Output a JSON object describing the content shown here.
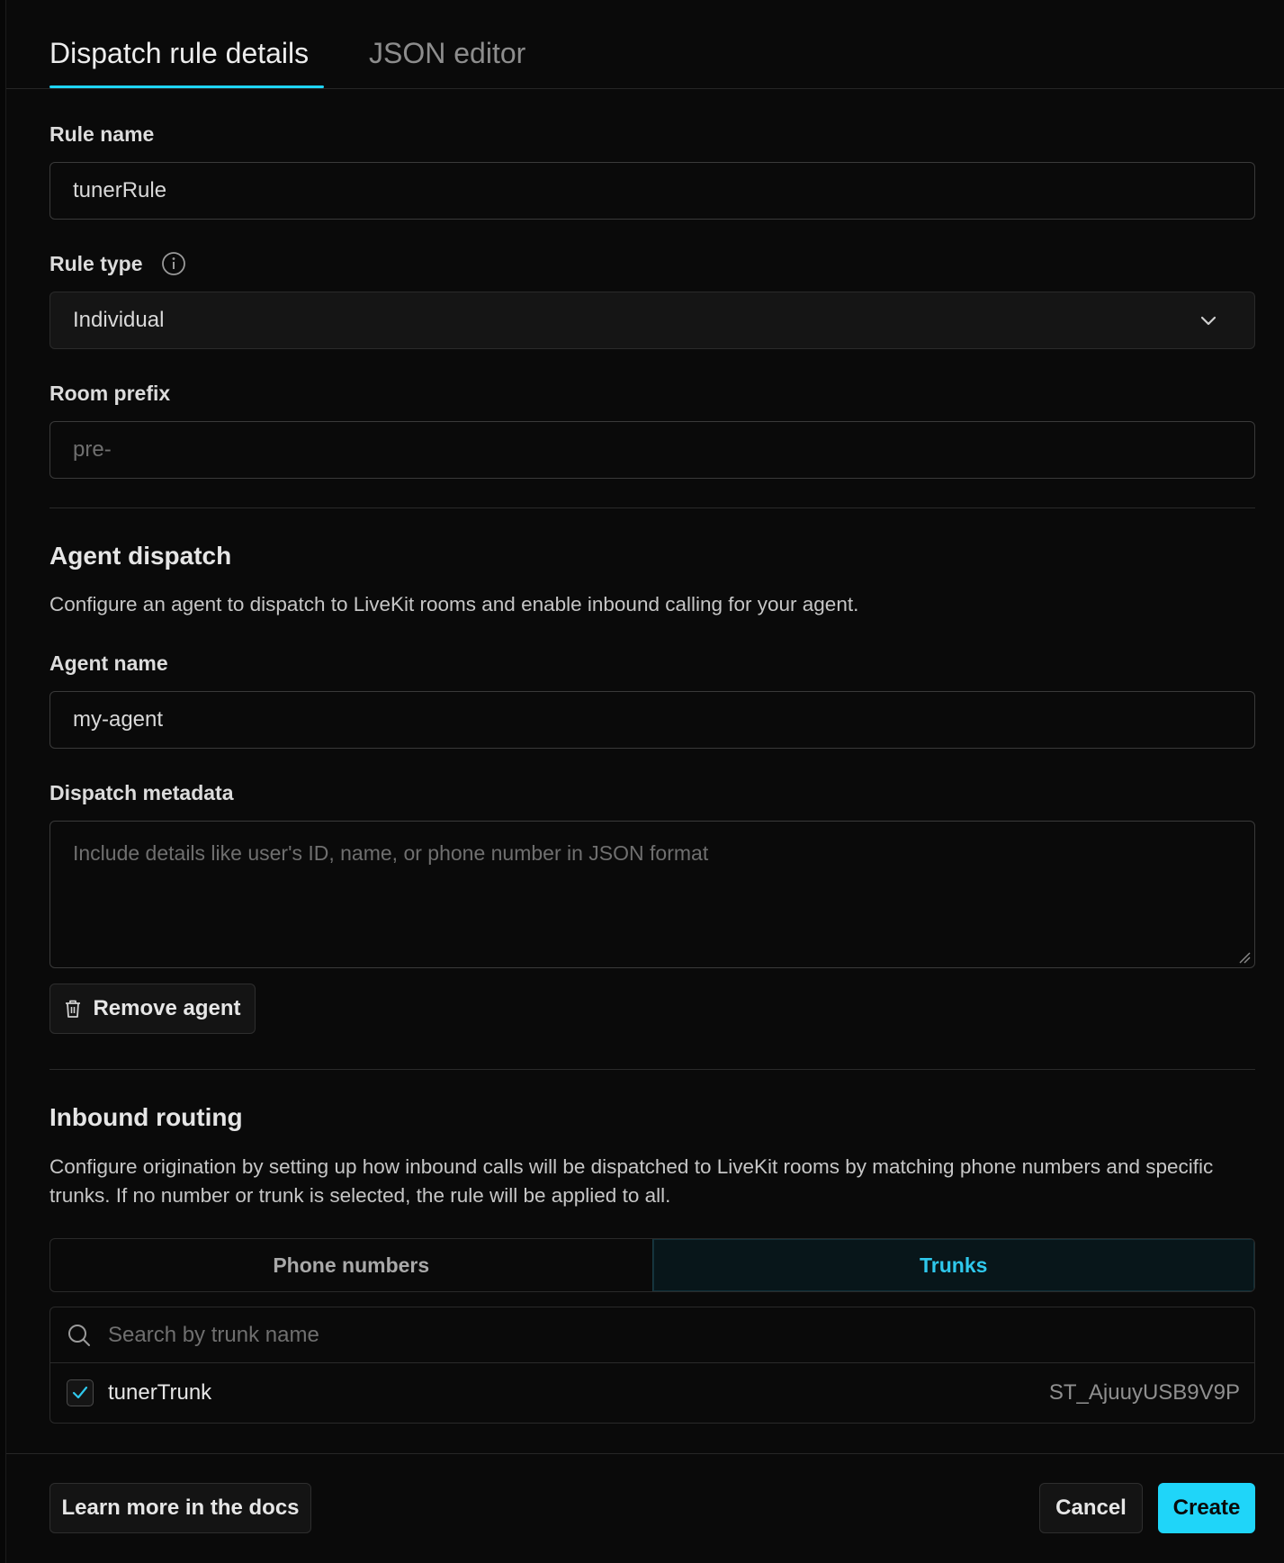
{
  "tabs": [
    {
      "label": "Dispatch rule details",
      "active": true
    },
    {
      "label": "JSON editor",
      "active": false
    }
  ],
  "rule_name": {
    "label": "Rule name",
    "value": "tunerRule"
  },
  "rule_type": {
    "label": "Rule type",
    "value": "Individual"
  },
  "room_prefix": {
    "label": "Room prefix",
    "placeholder": "pre-"
  },
  "agent_dispatch": {
    "heading": "Agent dispatch",
    "description": "Configure an agent to dispatch to LiveKit rooms and enable inbound calling for your agent.",
    "agent_name": {
      "label": "Agent name",
      "value": "my-agent"
    },
    "dispatch_metadata": {
      "label": "Dispatch metadata",
      "placeholder": "Include details like user's ID, name, or phone number in JSON format"
    },
    "remove_button": "Remove agent"
  },
  "inbound_routing": {
    "heading": "Inbound routing",
    "description": "Configure origination by setting up how inbound calls will be dispatched to LiveKit rooms by matching phone numbers and specific trunks. If no number or trunk is selected, the rule will be applied to all.",
    "segments": [
      {
        "label": "Phone numbers",
        "active": false
      },
      {
        "label": "Trunks",
        "active": true
      }
    ],
    "search_placeholder": "Search by trunk name",
    "trunks": [
      {
        "name": "tunerTrunk",
        "id": "ST_AjuuyUSB9V9P",
        "checked": true
      }
    ]
  },
  "footer": {
    "docs_button": "Learn more in the docs",
    "cancel_button": "Cancel",
    "create_button": "Create"
  },
  "colors": {
    "accent": "#1fd5f9",
    "background": "#0a0a0a"
  }
}
